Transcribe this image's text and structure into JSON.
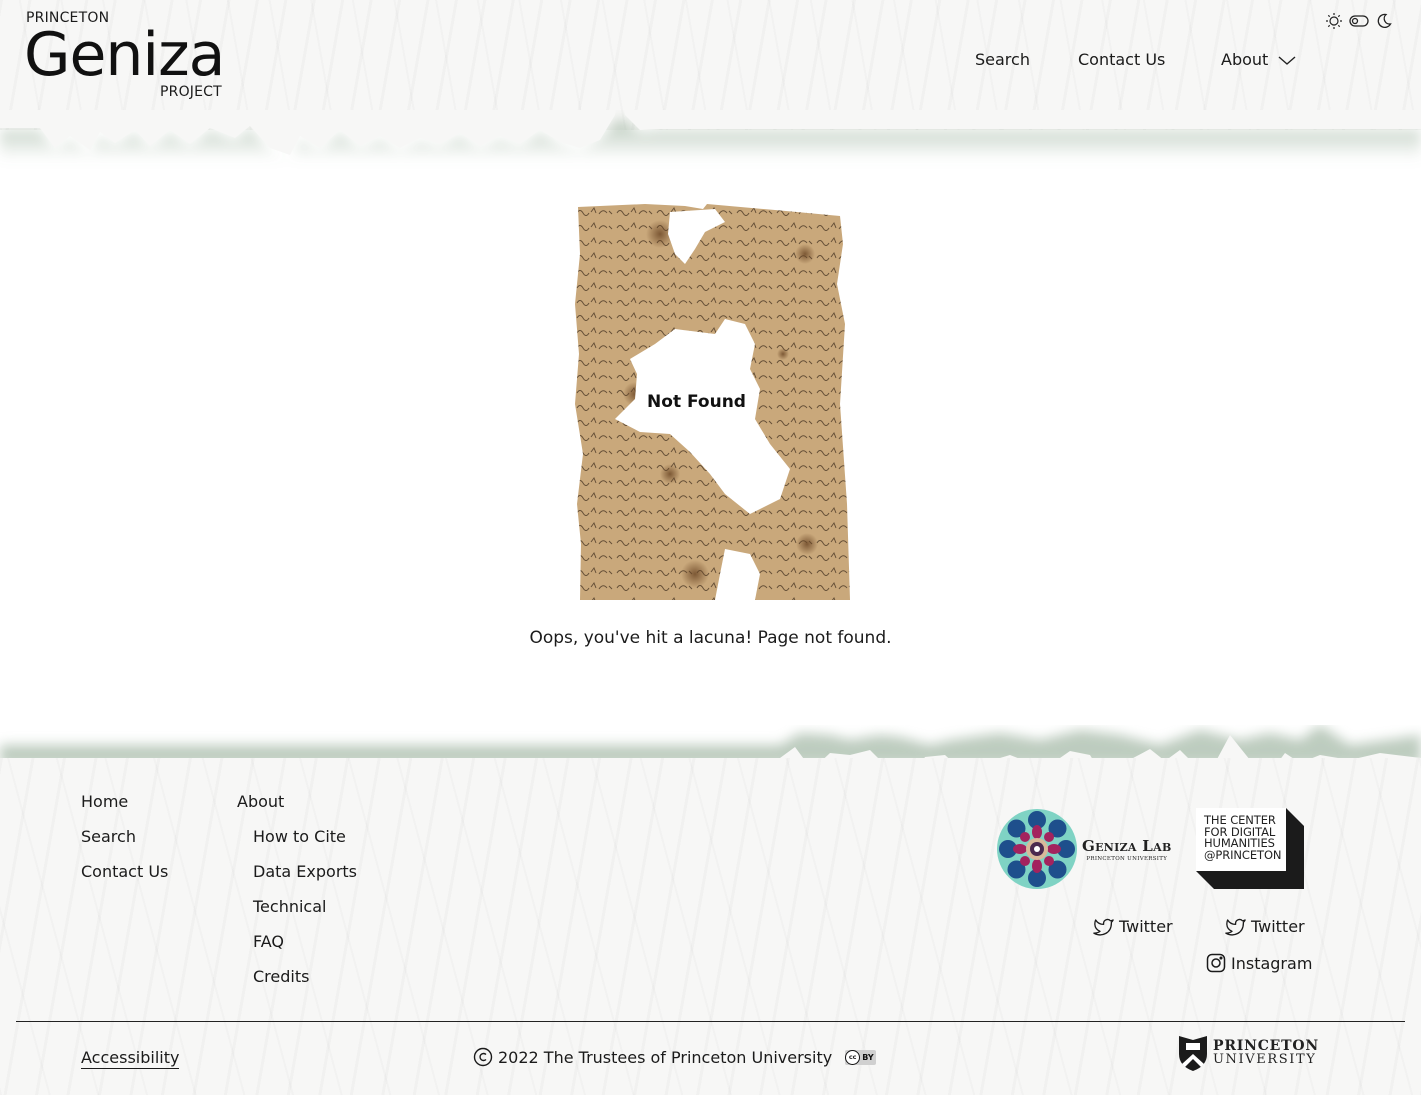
{
  "header": {
    "logo": {
      "top": "PRINCETON",
      "main": "Geniza",
      "bottom": "PROJECT"
    },
    "nav": [
      {
        "label": "Search"
      },
      {
        "label": "Contact Us"
      },
      {
        "label": "About",
        "has_dropdown": true
      }
    ],
    "theme_toggle": {
      "light_icon": "sun-icon",
      "toggle_icon": "toggle-icon",
      "dark_icon": "moon-icon"
    }
  },
  "main": {
    "image_caption": "Not Found",
    "message": "Oops, you've hit a lacuna! Page not found."
  },
  "footer": {
    "nav_primary": [
      {
        "label": "Home"
      },
      {
        "label": "Search"
      },
      {
        "label": "Contact Us"
      }
    ],
    "nav_about": {
      "label": "About",
      "items": [
        {
          "label": "How to Cite"
        },
        {
          "label": "Data Exports"
        },
        {
          "label": "Technical"
        },
        {
          "label": "FAQ"
        },
        {
          "label": "Credits"
        }
      ]
    },
    "geniza_lab": {
      "title": "Geniza Lab",
      "subtitle": "PRINCETON UNIVERSITY"
    },
    "cdh": {
      "lines": [
        "THE CENTER",
        "FOR DIGITAL",
        "HUMANITIES",
        "@PRINCETON"
      ]
    },
    "social": [
      {
        "label": "Twitter",
        "icon": "twitter-icon",
        "owner": "geniza-lab"
      },
      {
        "label": "Twitter",
        "icon": "twitter-icon",
        "owner": "cdh"
      },
      {
        "label": "Instagram",
        "icon": "instagram-icon",
        "owner": "cdh"
      }
    ],
    "accessibility": "Accessibility",
    "copyright": "2022 The Trustees of Princeton University",
    "license": {
      "cc": "cc",
      "by": "BY"
    },
    "princeton": {
      "line1": "PRINCETON",
      "line2": "UNIVERSITY"
    }
  },
  "colors": {
    "text": "#1b1b1b",
    "background": "#ffffff",
    "paper": "#f7f7f6",
    "edge_shadow": "#7d9a80"
  }
}
